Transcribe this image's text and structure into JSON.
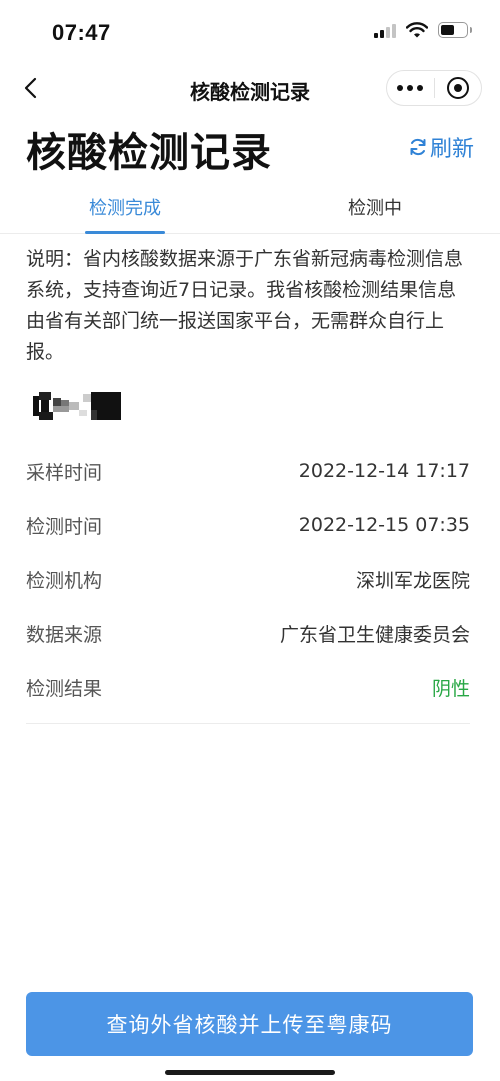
{
  "status_bar": {
    "time": "07:47"
  },
  "nav": {
    "title": "核酸检测记录"
  },
  "header": {
    "title": "核酸检测记录",
    "refresh_label": "刷新"
  },
  "tabs": [
    {
      "label": "检测完成",
      "active": true
    },
    {
      "label": "检测中",
      "active": false
    }
  ],
  "notice": "说明：省内核酸数据来源于广东省新冠病毒检测信息系统，支持查询近7日记录。我省核酸检测结果信息由省有关部门统一报送国家平台，无需群众自行上报。",
  "record": {
    "rows": [
      {
        "label": "采样时间",
        "value": "2022-12-14 17:17"
      },
      {
        "label": "检测时间",
        "value": "2022-12-15 07:35"
      },
      {
        "label": "检测机构",
        "value": "深圳军龙医院"
      },
      {
        "label": "数据来源",
        "value": "广东省卫生健康委员会"
      },
      {
        "label": "检测结果",
        "value": "阴性"
      }
    ]
  },
  "bottom_button": {
    "label": "查询外省核酸并上传至粤康码"
  },
  "colors": {
    "accent": "#3a8ad8",
    "button": "#4c95e6",
    "negative_result": "#28a745"
  }
}
